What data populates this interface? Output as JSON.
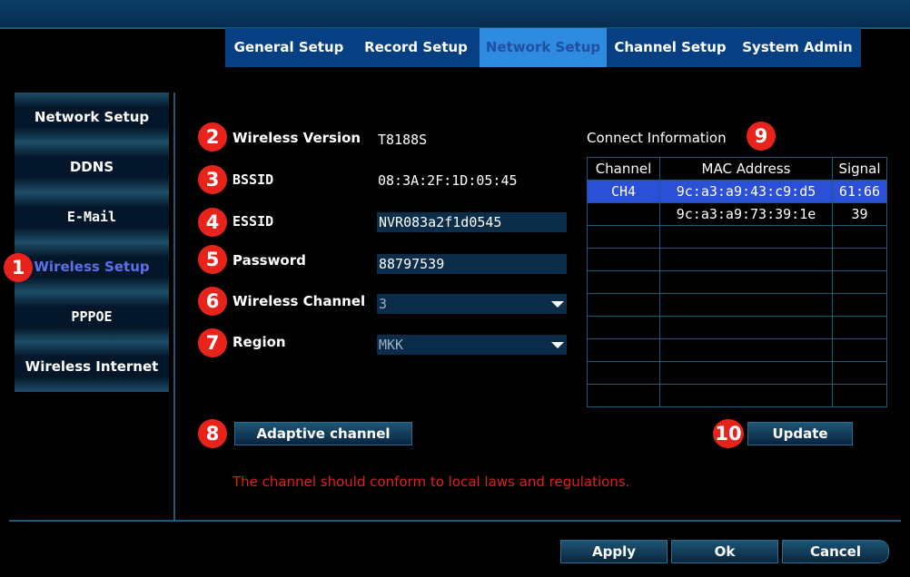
{
  "tabs": [
    {
      "label": "General Setup"
    },
    {
      "label": "Record Setup"
    },
    {
      "label": "Network Setup",
      "active": true
    },
    {
      "label": "Channel Setup"
    },
    {
      "label": "System Admin"
    }
  ],
  "sidebar": {
    "items": [
      {
        "label": "Network Setup"
      },
      {
        "label": "DDNS"
      },
      {
        "label": "E-Mail"
      },
      {
        "label": "Wireless Setup",
        "active": true
      },
      {
        "label": "PPPOE"
      },
      {
        "label": "Wireless Internet"
      }
    ]
  },
  "markers": [
    "1",
    "2",
    "3",
    "4",
    "5",
    "6",
    "7",
    "8",
    "9",
    "10"
  ],
  "form": {
    "wireless_version_label": "Wireless Version",
    "wireless_version_value": "T8188S",
    "bssid_label": "BSSID",
    "bssid_value": "08:3A:2F:1D:05:45",
    "essid_label": "ESSID",
    "essid_value": "NVR083a2f1d0545",
    "password_label": "Password",
    "password_value": "88797539",
    "channel_label": "Wireless Channel",
    "channel_value": "3",
    "region_label": "Region",
    "region_value": "MKK"
  },
  "connect_info": {
    "title": "Connect Information",
    "headers": [
      "Channel",
      "MAC Address",
      "Signal"
    ],
    "rows": [
      {
        "channel": "CH4",
        "mac": "9c:a3:a9:43:c9:d5",
        "signal": "61:66",
        "selected": true
      },
      {
        "channel": "",
        "mac": "9c:a3:a9:73:39:1e",
        "signal": "39"
      }
    ]
  },
  "buttons": {
    "adaptive": "Adaptive channel",
    "update": "Update",
    "apply": "Apply",
    "ok": "Ok",
    "cancel": "Cancel"
  },
  "notice": "The channel should conform to local laws and regulations.",
  "colors": {
    "active_tab_bg": "#2f8be0",
    "tab_bar_bg": "#063f82",
    "marker": "#e8231c",
    "selected_row": "#2b4fd6",
    "notice": "#e0201c"
  }
}
